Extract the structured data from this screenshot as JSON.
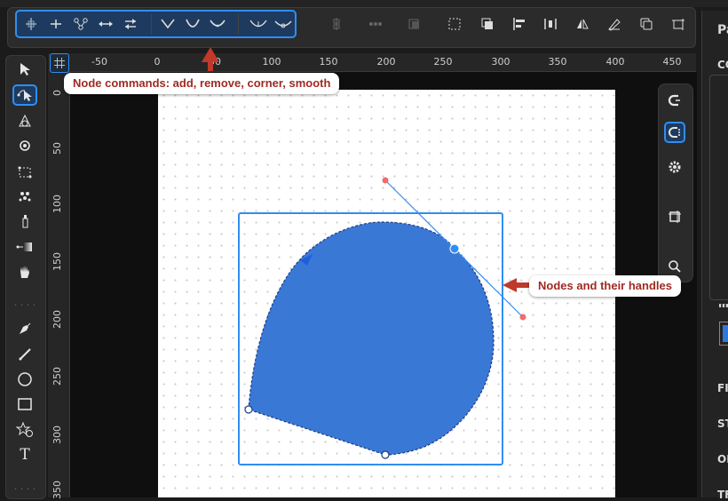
{
  "toolbar": {
    "node_commands": [
      "add-node",
      "remove-node",
      "join-nodes",
      "break-path",
      "reverse",
      "make-corner",
      "make-smooth",
      "make-symmetric",
      "cusp",
      "smooth-auto"
    ],
    "other_commands": [
      "distribute-vertical",
      "node-dots",
      "object-to-path",
      "select-rect",
      "arrange-front",
      "align-left",
      "align-center",
      "flip",
      "edit-path",
      "copy",
      "crop"
    ]
  },
  "tools": [
    "select",
    "node",
    "tweak",
    "zoom",
    "measure",
    "spray",
    "dropper",
    "gradient",
    "pan",
    "pen",
    "calligraphy",
    "ellipse",
    "rectangle",
    "star",
    "text"
  ],
  "ruler": {
    "h_labels": [
      "-50",
      "0",
      "50",
      "100",
      "150",
      "200",
      "250",
      "300",
      "350",
      "400",
      "450"
    ],
    "v_labels": [
      "0",
      "50",
      "100",
      "150",
      "200",
      "250",
      "300",
      "350"
    ]
  },
  "right_panel": {
    "title": "Pa",
    "labels": [
      "CO",
      "FI",
      "ST",
      "OF",
      "TF"
    ]
  },
  "callouts": {
    "node_commands": "Node commands: add, remove, corner, smooth",
    "nodes_handles": "Nodes and their handles"
  },
  "colors": {
    "accent": "#2f8ef3",
    "shape_fill": "#3a78d6",
    "callout_text": "#a02a22",
    "arrow": "#c0392b"
  }
}
